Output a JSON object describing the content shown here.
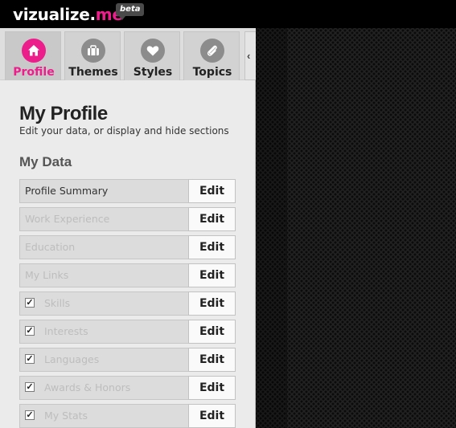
{
  "header": {
    "logo_main": "vizualize.",
    "logo_accent": "me",
    "beta_badge": "beta"
  },
  "tabs": [
    {
      "label": "Profile",
      "icon": "home-icon",
      "active": true
    },
    {
      "label": "Themes",
      "icon": "briefcase-icon",
      "active": false
    },
    {
      "label": "Styles",
      "icon": "heart-icon",
      "active": false
    },
    {
      "label": "Topics",
      "icon": "paperclip-icon",
      "active": false
    }
  ],
  "collapse_handle": "‹",
  "profile": {
    "title": "My Profile",
    "subtitle": "Edit your data, or display and hide sections",
    "section_title": "My Data"
  },
  "data_sections": [
    {
      "label": "Profile Summary",
      "enabled": true,
      "has_checkbox": false,
      "checked": false,
      "edit": "Edit"
    },
    {
      "label": "Work Experience",
      "enabled": false,
      "has_checkbox": false,
      "checked": false,
      "edit": "Edit"
    },
    {
      "label": "Education",
      "enabled": false,
      "has_checkbox": false,
      "checked": false,
      "edit": "Edit"
    },
    {
      "label": "My Links",
      "enabled": false,
      "has_checkbox": false,
      "checked": false,
      "edit": "Edit"
    },
    {
      "label": "Skills",
      "enabled": false,
      "has_checkbox": true,
      "checked": true,
      "edit": "Edit"
    },
    {
      "label": "Interests",
      "enabled": false,
      "has_checkbox": true,
      "checked": true,
      "edit": "Edit"
    },
    {
      "label": "Languages",
      "enabled": false,
      "has_checkbox": true,
      "checked": true,
      "edit": "Edit"
    },
    {
      "label": "Awards & Honors",
      "enabled": false,
      "has_checkbox": true,
      "checked": true,
      "edit": "Edit"
    },
    {
      "label": "My Stats",
      "enabled": false,
      "has_checkbox": true,
      "checked": true,
      "edit": "Edit"
    }
  ],
  "colors": {
    "accent": "#ec1e8c",
    "topbar": "#000000",
    "panel": "#ebebeb"
  }
}
